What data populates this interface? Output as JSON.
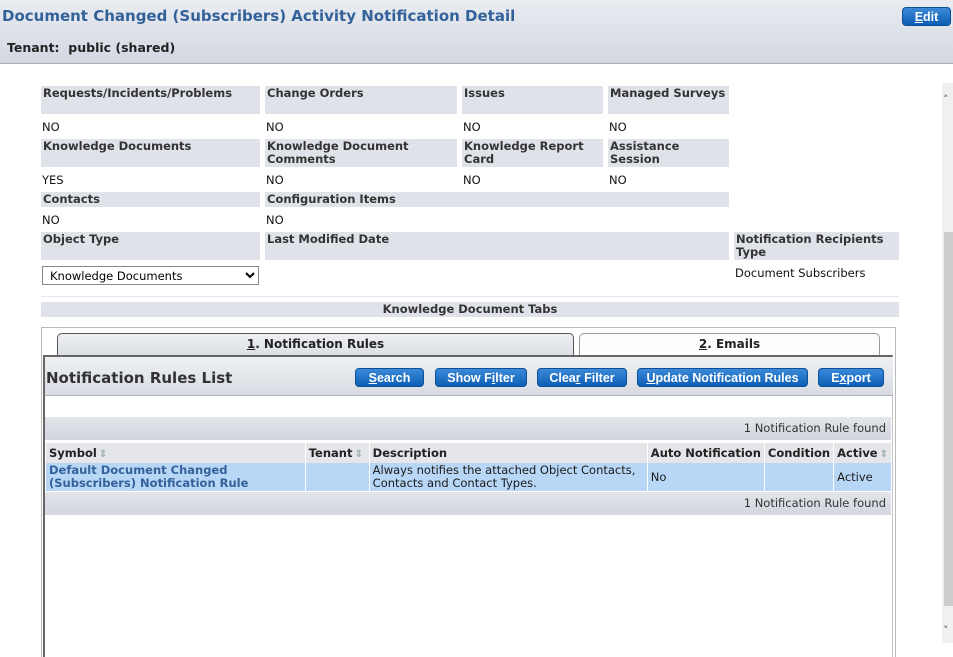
{
  "header": {
    "title": "Document Changed (Subscribers) Activity Notification Detail",
    "tenant_label": "Tenant:",
    "tenant_value": "public (shared)",
    "edit_button": {
      "accel": "E",
      "rest": "dit"
    }
  },
  "flags": [
    {
      "label": "Requests/Incidents/Problems",
      "value": "NO"
    },
    {
      "label": "Change Orders",
      "value": "NO"
    },
    {
      "label": "Issues",
      "value": "NO"
    },
    {
      "label": "Managed Surveys",
      "value": "NO"
    },
    {
      "label": "Knowledge Documents",
      "value": "YES"
    },
    {
      "label": "Knowledge Document Comments",
      "value": "NO"
    },
    {
      "label": "Knowledge Report Card",
      "value": "NO"
    },
    {
      "label": "Assistance Session",
      "value": "NO"
    },
    {
      "label": "Contacts",
      "value": "NO"
    },
    {
      "label": "Configuration Items",
      "value": "NO"
    }
  ],
  "details": {
    "object_type_label": "Object Type",
    "object_type_value": "Knowledge Documents",
    "last_modified_label": "Last Modified Date",
    "last_modified_value": "",
    "recipients_type_label": "Notification Recipients Type",
    "recipients_type_value": "Document Subscribers"
  },
  "tabs_section": {
    "title": "Knowledge Document Tabs",
    "tabs": [
      {
        "accel": "1",
        "label": ". Notification Rules",
        "active": true
      },
      {
        "accel": "2",
        "label": ". Emails",
        "active": false
      }
    ]
  },
  "list": {
    "title": "Notification Rules List",
    "buttons": [
      {
        "pre": "",
        "accel": "S",
        "post": "earch"
      },
      {
        "pre": "Show F",
        "accel": "i",
        "post": "lter"
      },
      {
        "pre": "Clea",
        "accel": "r",
        "post": " Filter"
      },
      {
        "pre": "",
        "accel": "U",
        "post": "pdate Notification Rules"
      },
      {
        "pre": "E",
        "accel": "x",
        "post": "port"
      }
    ],
    "found_text": "1 Notification Rule found",
    "columns": [
      "Symbol",
      "Tenant",
      "Description",
      "Auto Notification",
      "Condition",
      "Active"
    ],
    "rows": [
      {
        "symbol": "Default Document Changed (Subscribers) Notification Rule",
        "tenant": "",
        "description": "Always notifies the attached Object Contacts, Contacts and Contact Types.",
        "auto_notification": "No",
        "condition": "",
        "active": "Active"
      }
    ]
  },
  "icons": {
    "sort": "⇕",
    "scroll_up": "︿",
    "scroll_down": "﹀"
  }
}
